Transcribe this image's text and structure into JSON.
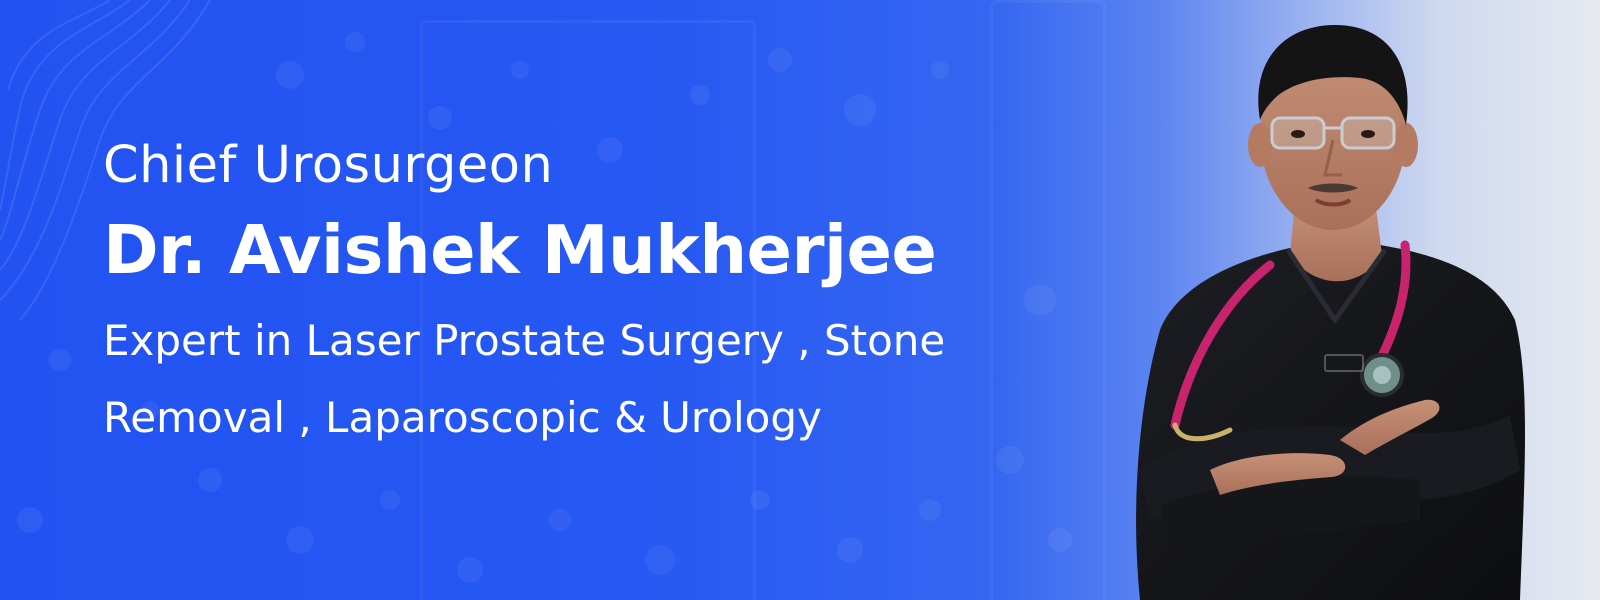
{
  "banner": {
    "subtitle": "Chief Urosurgeon",
    "name": "Dr. Avishek Mukherjee",
    "description": "Expert in Laser Prostate Surgery , Stone Removal , Laparoscopic & Urology"
  },
  "colors": {
    "background": "#2457f0",
    "text": "#ffffff",
    "scrubs": "#15161a",
    "stethoscope": "#c8246e"
  },
  "icons": [
    "contour-lines-decoration",
    "bokeh-dots-decoration",
    "doctor-portrait"
  ]
}
